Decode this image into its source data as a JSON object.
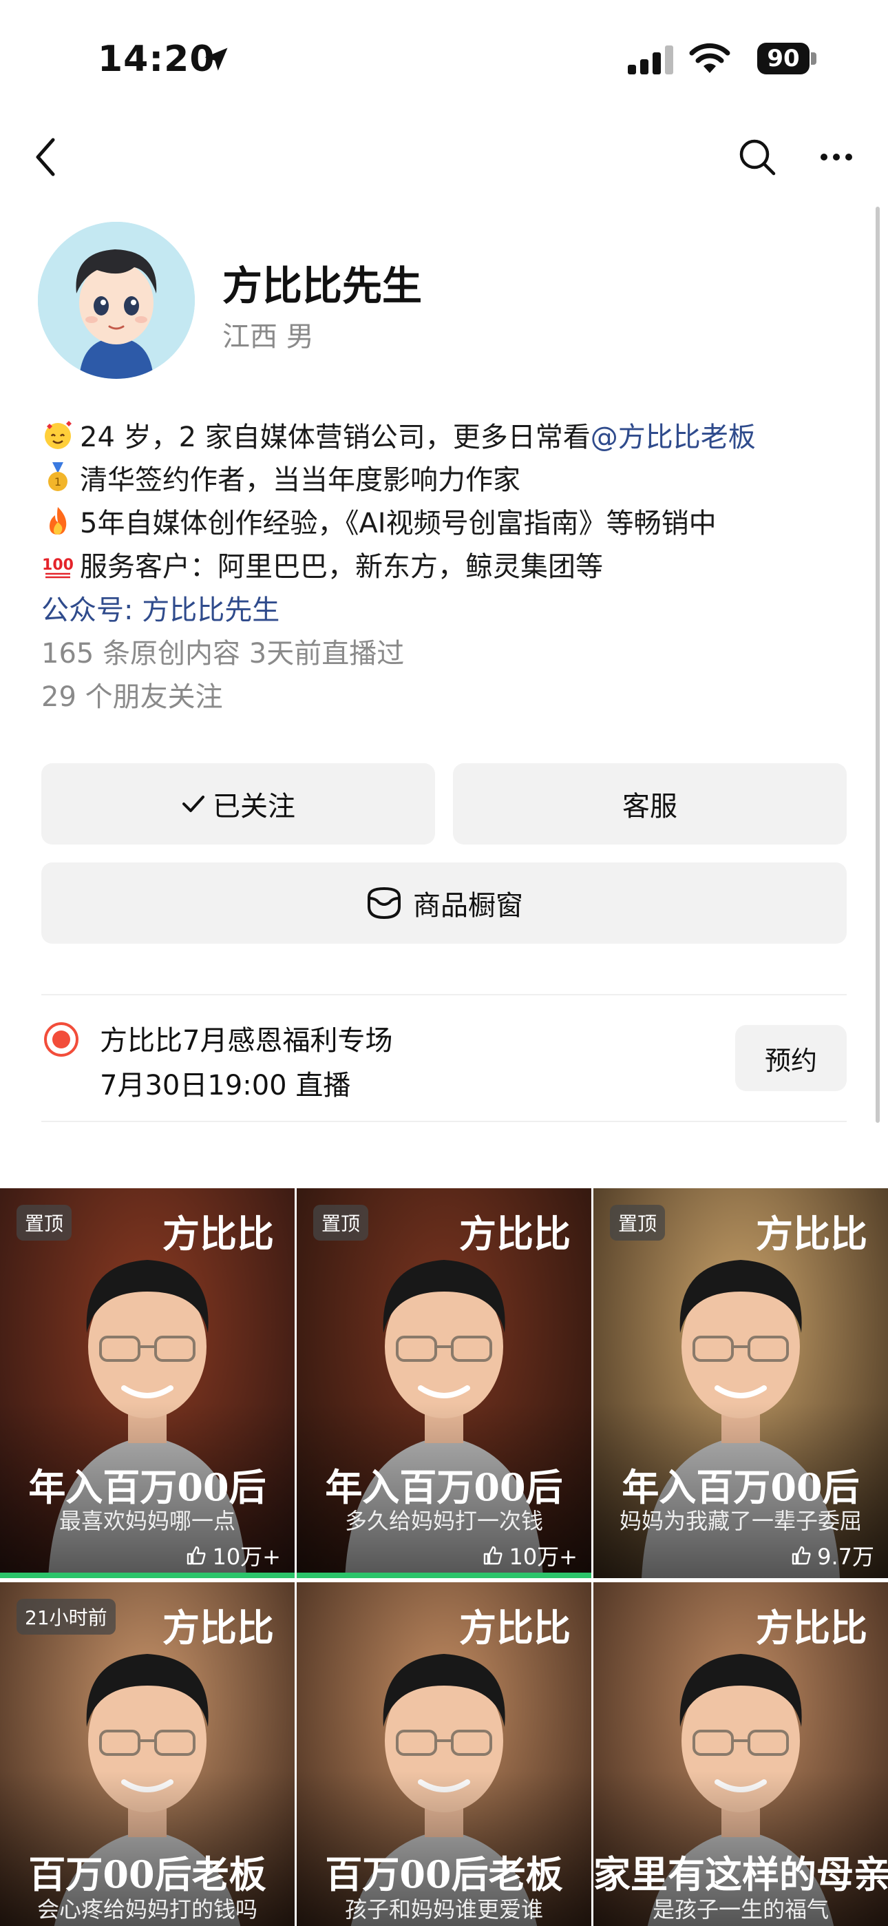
{
  "status_bar": {
    "time": "14:20",
    "battery": "90"
  },
  "profile": {
    "name": "方比比先生",
    "meta": "江西 男",
    "bio": [
      {
        "emoji": "smiling-hearts",
        "text": "24 岁，2 家自媒体营销公司，更多日常看",
        "link": "@方比比老板"
      },
      {
        "emoji": "medal",
        "text": "清华签约作者，当当年度影响力作家"
      },
      {
        "emoji": "fire",
        "text": "5年自媒体创作经验，《AI视频号创富指南》等畅销中"
      },
      {
        "emoji": "hundred",
        "text": "服务客户：阿里巴巴，新东方，鲸灵集团等"
      }
    ],
    "official_account": "公众号: 方比比先生",
    "stats": "165 条原创内容   3天前直播过",
    "friends": "29 个朋友关注"
  },
  "actions": {
    "follow": "已关注",
    "service": "客服",
    "shop": "商品橱窗"
  },
  "live": {
    "title": "方比比7月感恩福利专场",
    "subtitle": "7月30日19:00 直播",
    "reserve": "预约"
  },
  "videos": [
    {
      "badge": "置顶",
      "brand": "方比比",
      "headline": "年入百万00后",
      "sub": "最喜欢妈妈哪一点",
      "likes": "10万+",
      "bg": [
        "#8a3a22",
        "#2a1410"
      ],
      "progress": true
    },
    {
      "badge": "置顶",
      "brand": "方比比",
      "headline": "年入百万00后",
      "sub": "多久给妈妈打一次钱",
      "likes": "10万+",
      "bg": [
        "#7a3520",
        "#24120c"
      ],
      "progress": true
    },
    {
      "badge": "置顶",
      "brand": "方比比",
      "headline": "年入百万00后",
      "sub": "妈妈为我藏了一辈子委屈",
      "likes": "9.7万",
      "bg": [
        "#c9a26a",
        "#3a2a1a"
      ],
      "progress": false
    },
    {
      "badge": "21小时前",
      "brand": "方比比",
      "headline": "百万00后老板",
      "sub": "会心疼给妈妈打的钱吗",
      "likes": "",
      "bg": [
        "#c8946a",
        "#3a2418"
      ],
      "progress": false
    },
    {
      "badge": "",
      "brand": "方比比",
      "headline": "百万00后老板",
      "sub": "孩子和妈妈谁更爱谁",
      "likes": "",
      "bg": [
        "#c28c62",
        "#3a2418"
      ],
      "progress": false
    },
    {
      "badge": "",
      "brand": "方比比",
      "headline": "家里有这样的母亲",
      "sub": "是孩子一生的福气",
      "likes": "",
      "bg": [
        "#be8a62",
        "#3a2418"
      ],
      "progress": false
    }
  ]
}
